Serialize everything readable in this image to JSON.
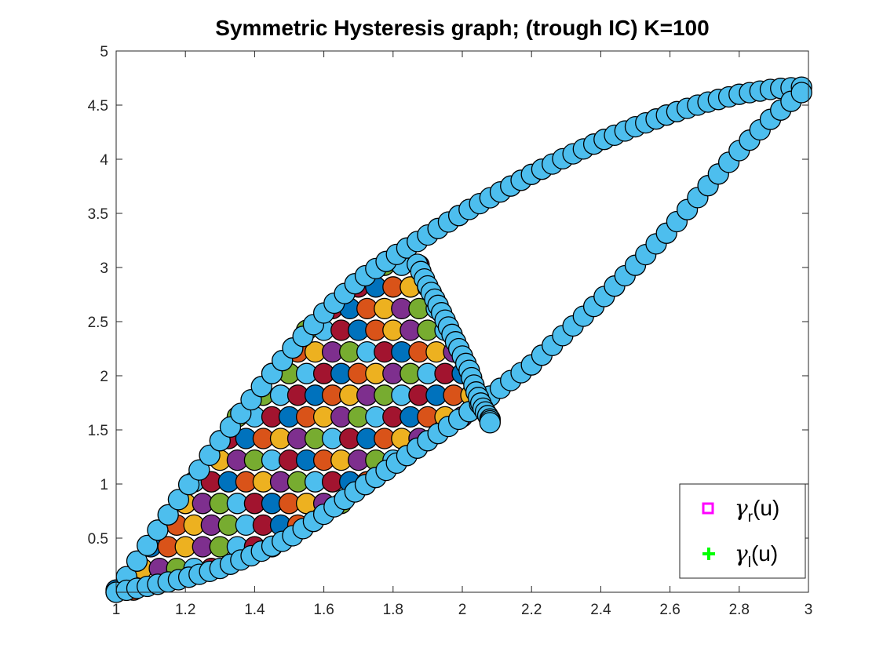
{
  "chart_data": {
    "type": "scatter",
    "title": "Symmetric Hysteresis graph; (trough IC) K=100",
    "xlabel": "",
    "ylabel": "",
    "xlim": [
      1,
      3
    ],
    "ylim": [
      0,
      5
    ],
    "xticks": [
      "1",
      "1.2",
      "1.4",
      "1.6",
      "1.8",
      "2",
      "2.2",
      "2.4",
      "2.6",
      "2.8",
      "3"
    ],
    "yticks": [
      "0.5",
      "1",
      "1.5",
      "2",
      "2.5",
      "3",
      "3.5",
      "4",
      "4.5",
      "5"
    ],
    "grid": false,
    "legend_position": "bottom-right",
    "legend": [
      {
        "label_main": "γ",
        "label_sub": "r",
        "label_tail": "(u)",
        "marker": "square",
        "color": "#ff00ff"
      },
      {
        "label_main": "γ",
        "label_sub": "l",
        "label_tail": "(u)",
        "marker": "plus",
        "color": "#00ff00"
      }
    ],
    "marker_colors": [
      "#0072bd",
      "#d95319",
      "#edb120",
      "#7e2f8e",
      "#77ac30",
      "#4dbeee",
      "#a2142f"
    ],
    "outer_upper_branch": {
      "x": [
        1.0,
        1.1,
        1.2,
        1.3,
        1.4,
        1.5,
        1.6,
        1.7,
        1.8,
        1.9,
        2.0,
        2.1,
        2.2,
        2.3,
        2.4,
        2.5,
        2.6,
        2.7,
        2.8,
        2.9,
        3.0
      ],
      "y": [
        0.0,
        0.48,
        0.95,
        1.4,
        1.82,
        2.22,
        2.58,
        2.88,
        3.1,
        3.3,
        3.5,
        3.68,
        3.86,
        4.02,
        4.17,
        4.3,
        4.42,
        4.52,
        4.6,
        4.65,
        4.67
      ]
    },
    "outer_lower_branch": {
      "x": [
        1.0,
        1.1,
        1.2,
        1.3,
        1.4,
        1.5,
        1.6,
        1.7,
        1.8,
        1.9,
        2.0,
        2.1,
        2.2,
        2.3,
        2.4,
        2.5,
        2.6,
        2.7,
        2.8,
        2.9,
        3.0
      ],
      "y": [
        0.0,
        0.06,
        0.13,
        0.22,
        0.35,
        0.5,
        0.72,
        0.95,
        1.17,
        1.4,
        1.62,
        1.86,
        2.1,
        2.4,
        2.7,
        3.02,
        3.35,
        3.72,
        4.08,
        4.4,
        4.67
      ]
    },
    "inner_descent_branch": {
      "x": [
        1.87,
        1.9,
        1.93,
        1.96,
        1.99,
        2.02,
        2.04,
        2.06,
        2.08,
        2.08
      ],
      "y": [
        3.03,
        2.83,
        2.65,
        2.45,
        2.25,
        2.05,
        1.85,
        1.7,
        1.6,
        1.55
      ]
    }
  }
}
